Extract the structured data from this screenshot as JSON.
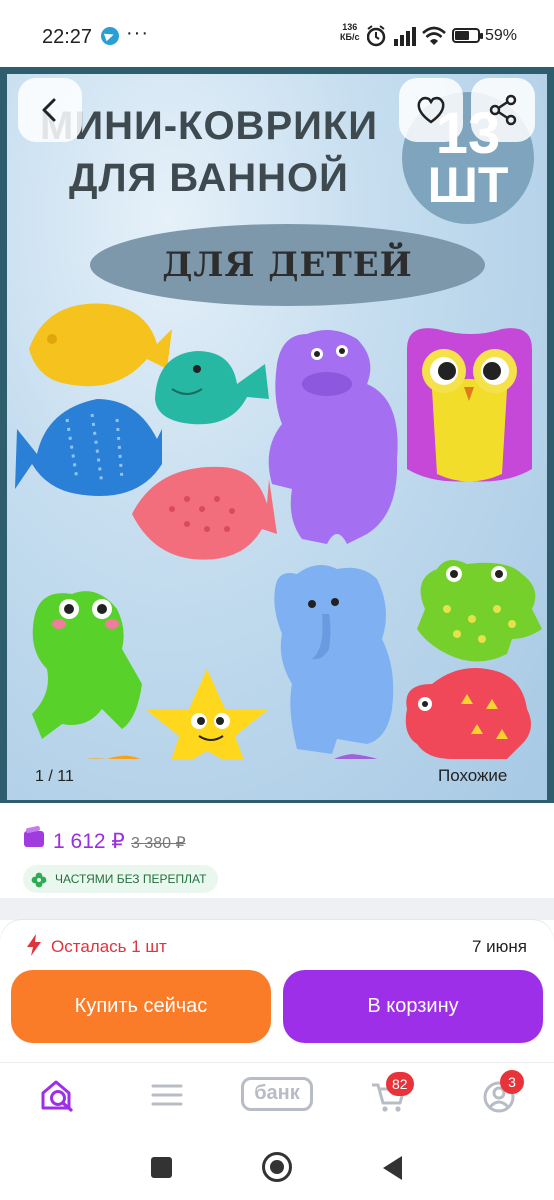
{
  "status_bar": {
    "time": "22:27",
    "more": "···",
    "speed_value": "136",
    "speed_unit": "КБ/с",
    "battery": "59%"
  },
  "product_image": {
    "title_line1": "МИНИ-КОВРИКИ",
    "title_line2": "ДЛЯ ВАННОЙ",
    "badge_number": "13",
    "badge_unit": "ШТ",
    "subtitle": "ДЛЯ ДЕТЕЙ",
    "counter": "1 / 11",
    "similar_label": "Похожие"
  },
  "price": {
    "current": "1 612 ₽",
    "old": "3 380 ₽",
    "installment": "ЧАСТЯМИ БЕЗ ПЕРЕПЛАТ"
  },
  "stock": {
    "remaining": "Осталась 1 шт",
    "delivery_date": "7 июня"
  },
  "actions": {
    "buy_now": "Купить сейчас",
    "add_to_cart": "В корзину"
  },
  "tab_bar": {
    "bank_label": "банк",
    "cart_badge": "82",
    "profile_badge": "3"
  },
  "colors": {
    "accent_purple": "#9e2fe8",
    "accent_orange": "#fb7c28",
    "badge_red": "#e8333a",
    "installment_green": "#24703c"
  }
}
